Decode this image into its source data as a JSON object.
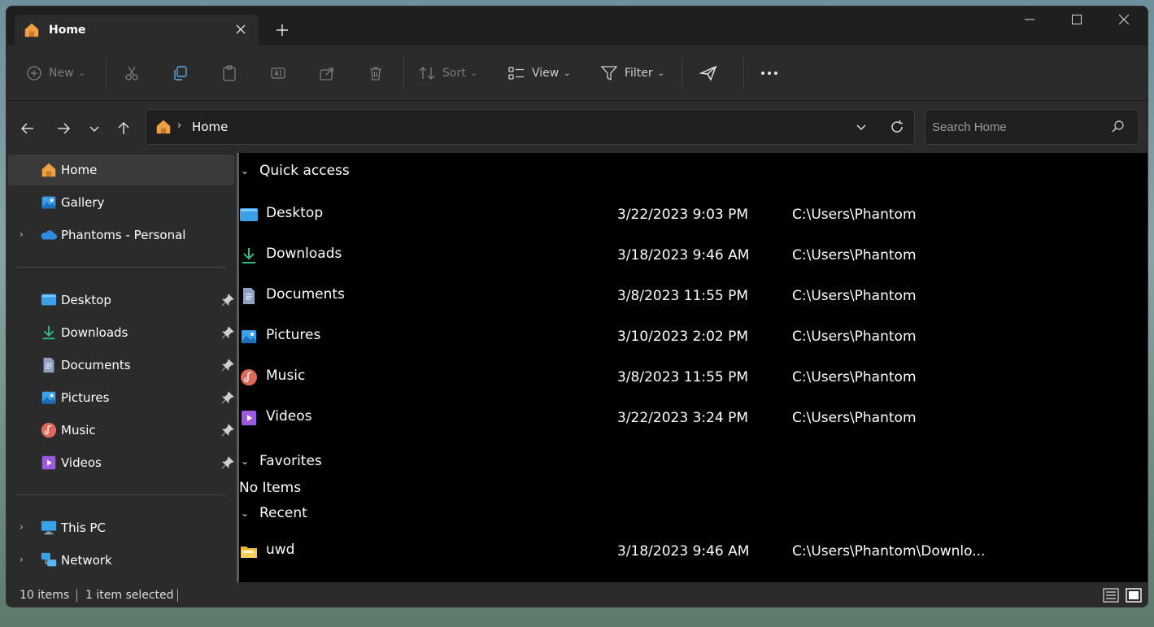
{
  "window": {
    "tab_title": "Home",
    "tab_icon": "home-icon",
    "new_tab_symbol": "+",
    "controls": [
      "minimize-icon",
      "maximize-icon",
      "close-icon"
    ]
  },
  "toolbar": {
    "new_label": "New",
    "sort_label": "Sort",
    "view_label": "View",
    "filter_label": "Filter"
  },
  "address": {
    "crumb_separator": "›",
    "crumb": "Home",
    "search_placeholder": "Search Home"
  },
  "sidebar": {
    "top": [
      {
        "label": "Home",
        "icon": "home-icon",
        "selected": true
      },
      {
        "label": "Gallery",
        "icon": "gallery-icon"
      },
      {
        "label": "Phantoms - Personal",
        "icon": "onedrive-icon",
        "expandable": true
      }
    ],
    "pinned": [
      {
        "label": "Desktop",
        "icon": "desktop-folder-icon"
      },
      {
        "label": "Downloads",
        "icon": "downloads-icon"
      },
      {
        "label": "Documents",
        "icon": "documents-icon"
      },
      {
        "label": "Pictures",
        "icon": "pictures-icon"
      },
      {
        "label": "Music",
        "icon": "music-icon"
      },
      {
        "label": "Videos",
        "icon": "videos-icon"
      }
    ],
    "bottom": [
      {
        "label": "This PC",
        "icon": "this-pc-icon",
        "expandable": true
      },
      {
        "label": "Network",
        "icon": "network-icon",
        "expandable": true
      }
    ]
  },
  "main": {
    "quick_access": {
      "header": "Quick access",
      "items": [
        {
          "name": "Desktop",
          "date": "3/22/2023 9:03 PM",
          "location": "C:\\Users\\Phantom"
        },
        {
          "name": "Downloads",
          "date": "3/18/2023 9:46 AM",
          "location": "C:\\Users\\Phantom"
        },
        {
          "name": "Documents",
          "date": "3/8/2023 11:55 PM",
          "location": "C:\\Users\\Phantom"
        },
        {
          "name": "Pictures",
          "date": "3/10/2023 2:02 PM",
          "location": "C:\\Users\\Phantom"
        },
        {
          "name": "Music",
          "date": "3/8/2023 11:55 PM",
          "location": "C:\\Users\\Phantom"
        },
        {
          "name": "Videos",
          "date": "3/22/2023 3:24 PM",
          "location": "C:\\Users\\Phantom"
        }
      ]
    },
    "favorites": {
      "header": "Favorites",
      "empty_text": "No Items"
    },
    "recent": {
      "header": "Recent",
      "items": [
        {
          "name": "uwd",
          "date": "3/18/2023 9:46 AM",
          "location": "C:\\Users\\Phantom\\Downlo..."
        }
      ]
    }
  },
  "status": {
    "item_count": "10 items",
    "selection": "1 item selected"
  },
  "colors": {
    "window_bg": "#000000",
    "chrome_bg": "#2b2b2b",
    "accent_blue": "#3aa0e8",
    "home_orange": "#f0a040"
  }
}
